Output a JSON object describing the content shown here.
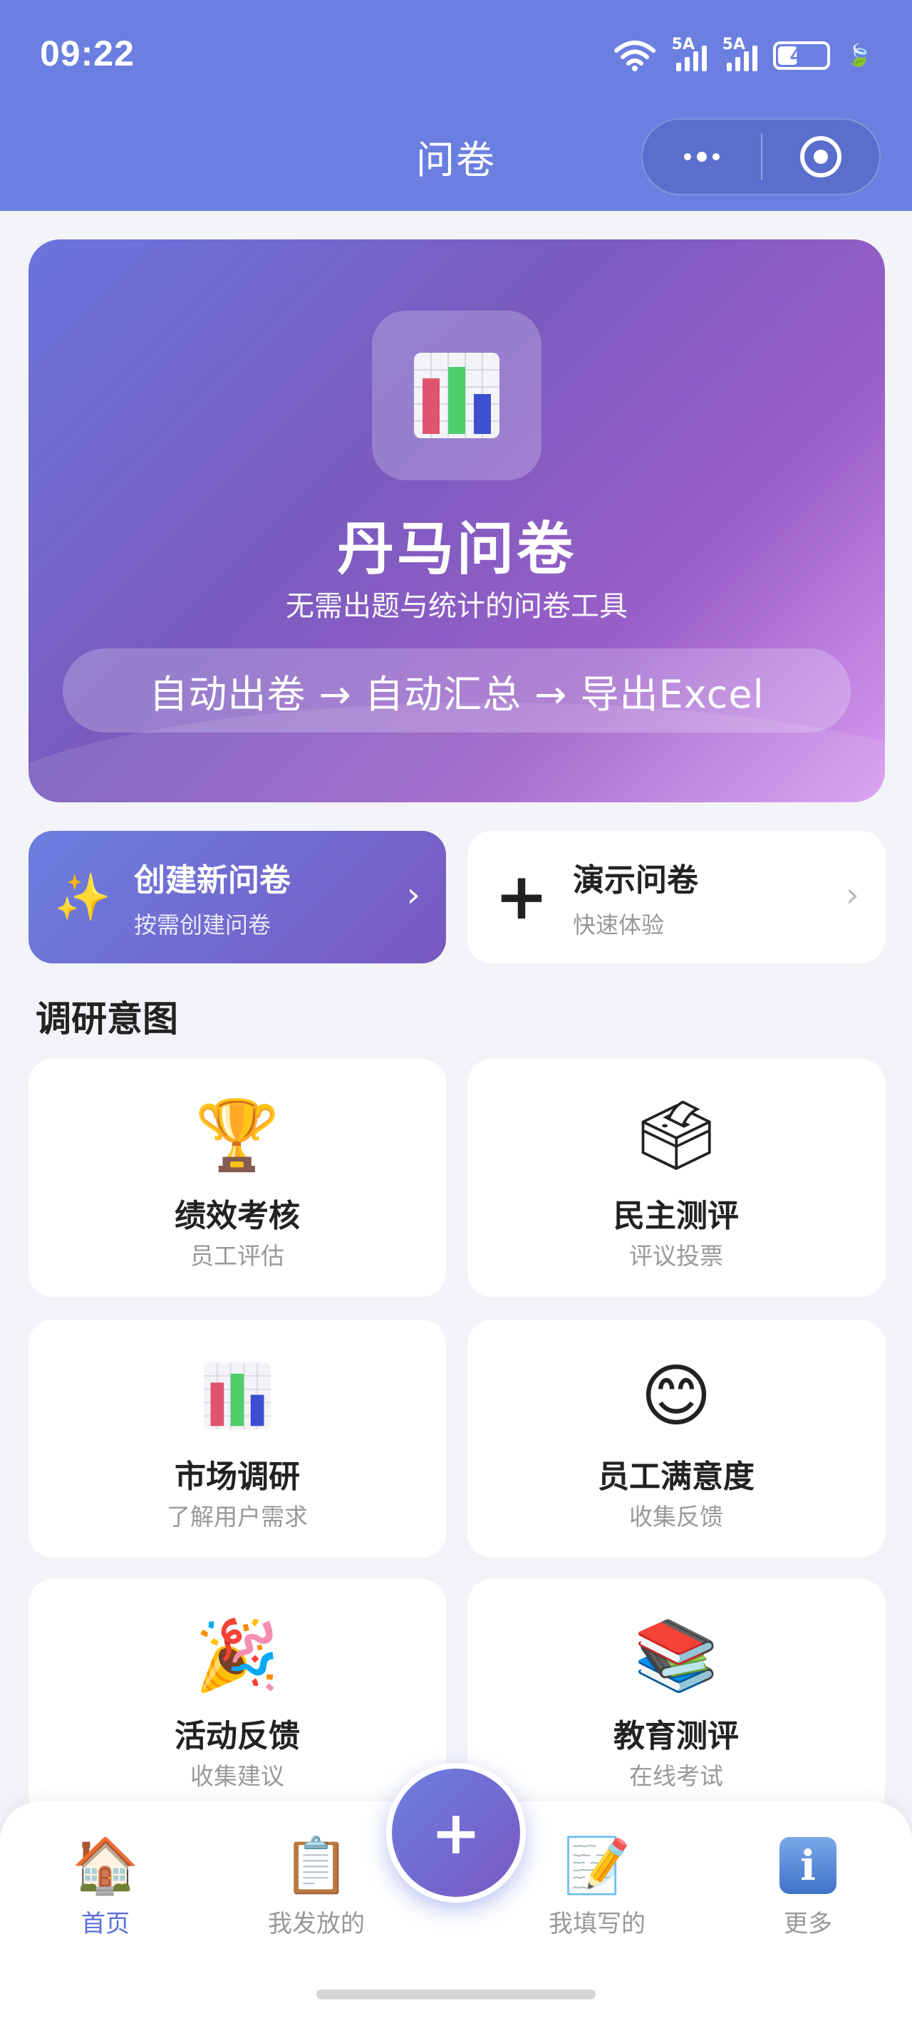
{
  "status_bar": {
    "time": "09:22",
    "net_1": "5A",
    "net_2": "5A",
    "battery": "47",
    "battery_level_percent": 47
  },
  "header": {
    "title": "问卷"
  },
  "hero": {
    "title": "丹马问卷",
    "subtitle": "无需出题与统计的问卷工具",
    "flow": "自动出卷 → 自动汇总 → 导出Excel",
    "icon": "bar-chart-icon"
  },
  "actions": {
    "create": {
      "title": "创建新问卷",
      "desc": "按需创建问卷",
      "icon": "sparkles-icon"
    },
    "demo": {
      "title": "演示问卷",
      "desc": "快速体验",
      "icon": "plus-icon"
    }
  },
  "section": {
    "title": "调研意图"
  },
  "intents": [
    {
      "title": "绩效考核",
      "desc": "员工评估",
      "icon": "trophy-icon"
    },
    {
      "title": "民主测评",
      "desc": "评议投票",
      "icon": "ballot-box-icon"
    },
    {
      "title": "市场调研",
      "desc": "了解用户需求",
      "icon": "bar-chart-icon"
    },
    {
      "title": "员工满意度",
      "desc": "收集反馈",
      "icon": "smiley-icon"
    },
    {
      "title": "活动反馈",
      "desc": "收集建议",
      "icon": "party-popper-icon"
    },
    {
      "title": "教育测评",
      "desc": "在线考试",
      "icon": "books-icon"
    }
  ],
  "nav": {
    "home": "首页",
    "published": "我发放的",
    "filled": "我填写的",
    "more": "更多",
    "fab": "+"
  },
  "colors": {
    "brand": "#6b7fe0",
    "brand_purple": "#7858c0",
    "active_nav": "#5b6fd8"
  }
}
